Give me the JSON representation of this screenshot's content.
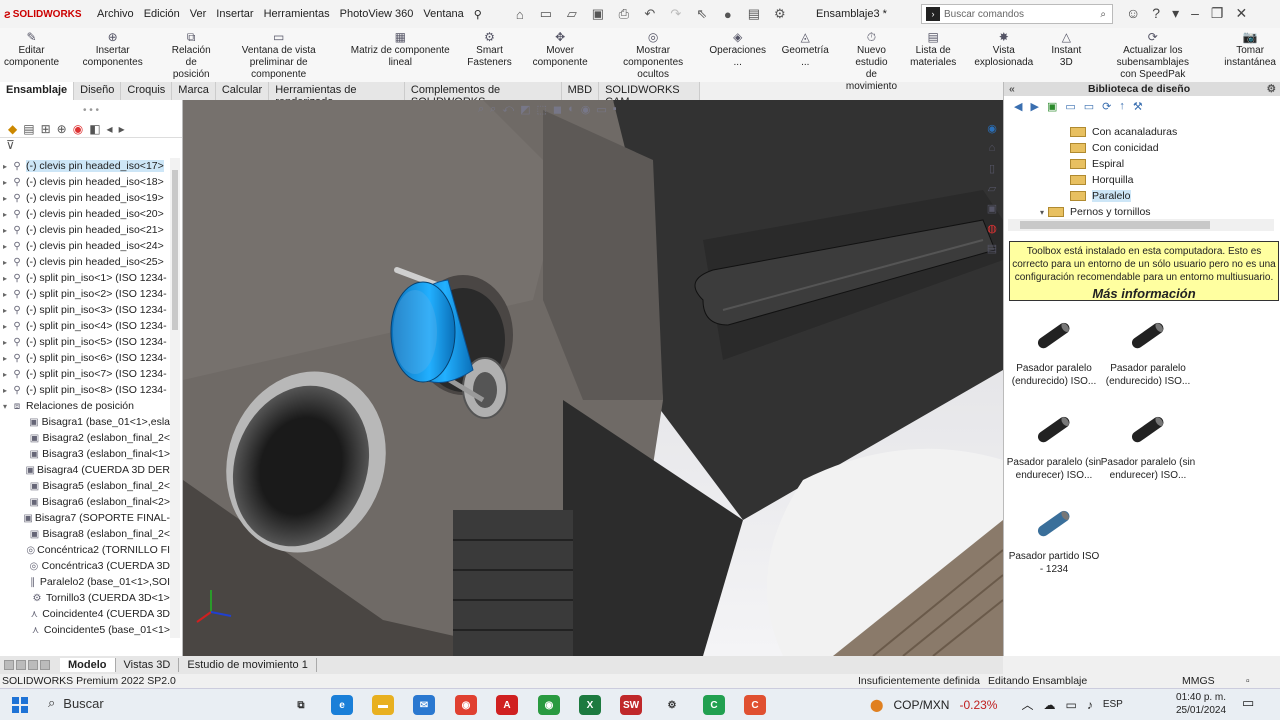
{
  "app": {
    "brand": "SOLIDWORKS",
    "doc_title": "Ensamblaje3 *"
  },
  "menu": [
    "Archivo",
    "Edición",
    "Ver",
    "Insertar",
    "Herramientas",
    "PhotoView 360",
    "Ventana"
  ],
  "search": {
    "placeholder": "Buscar comandos"
  },
  "ribbon": [
    {
      "label": "Editar\ncomponente",
      "icon": "edit-component-icon"
    },
    {
      "label": "Insertar componentes",
      "icon": "insert-components-icon"
    },
    {
      "label": "Relación de\nposición",
      "icon": "mate-icon"
    },
    {
      "label": "Ventana de vista\npreliminar de componente",
      "icon": "preview-window-icon"
    },
    {
      "label": "Matriz de componente lineal",
      "icon": "linear-pattern-icon"
    },
    {
      "label": "Smart\nFasteners",
      "icon": "smart-fasteners-icon"
    },
    {
      "label": "Mover componente",
      "icon": "move-component-icon"
    },
    {
      "label": "Mostrar\ncomponentes ocultos",
      "icon": "show-hidden-icon"
    },
    {
      "label": "Operaciones ...",
      "icon": "features-icon"
    },
    {
      "label": "Geometría ...",
      "icon": "geometry-icon"
    },
    {
      "label": "Nuevo estudio\nde movimiento",
      "icon": "motion-study-icon"
    },
    {
      "label": "Lista de\nmateriales",
      "icon": "bom-icon"
    },
    {
      "label": "Vista explosionada",
      "icon": "exploded-view-icon"
    },
    {
      "label": "Instant\n3D",
      "icon": "instant3d-icon"
    },
    {
      "label": "Actualizar los subensamblajes\ncon SpeedPak",
      "icon": "speedpak-icon"
    },
    {
      "label": "Tomar\ninstantánea",
      "icon": "snapshot-icon"
    }
  ],
  "tabs": [
    "Ensamblaje",
    "Diseño",
    "Croquis",
    "Marca",
    "Calcular",
    "Herramientas de renderizado",
    "Complementos de SOLIDWORKS",
    "MBD",
    "SOLIDWORKS CAM"
  ],
  "tree": [
    {
      "label": "(-) clevis pin headed_iso<17>",
      "icon": "part-icon",
      "selected": true
    },
    {
      "label": "(-) clevis pin headed_iso<18>",
      "icon": "part-icon"
    },
    {
      "label": "(-) clevis pin headed_iso<19>",
      "icon": "part-icon"
    },
    {
      "label": "(-) clevis pin headed_iso<20>",
      "icon": "part-icon"
    },
    {
      "label": "(-) clevis pin headed_iso<21>",
      "icon": "part-icon"
    },
    {
      "label": "(-) clevis pin headed_iso<24>",
      "icon": "part-icon"
    },
    {
      "label": "(-) clevis pin headed_iso<25>",
      "icon": "part-icon"
    },
    {
      "label": "(-) split pin_iso<1> (ISO 1234-",
      "icon": "part-icon"
    },
    {
      "label": "(-) split pin_iso<2> (ISO 1234-",
      "icon": "part-icon"
    },
    {
      "label": "(-) split pin_iso<3> (ISO 1234-",
      "icon": "part-icon"
    },
    {
      "label": "(-) split pin_iso<4> (ISO 1234-",
      "icon": "part-icon"
    },
    {
      "label": "(-) split pin_iso<5> (ISO 1234-",
      "icon": "part-icon"
    },
    {
      "label": "(-) split pin_iso<6> (ISO 1234-",
      "icon": "part-icon"
    },
    {
      "label": "(-) split pin_iso<7> (ISO 1234-",
      "icon": "part-icon"
    },
    {
      "label": "(-) split pin_iso<8> (ISO 1234-",
      "icon": "part-icon"
    },
    {
      "label": "Relaciones de posición",
      "icon": "mates-folder-icon",
      "level": 0
    },
    {
      "label": "Bisagra1 (base_01<1>,esla",
      "icon": "hinge-icon",
      "level": 1
    },
    {
      "label": "Bisagra2 (eslabon_final_2<",
      "icon": "hinge-icon",
      "level": 1
    },
    {
      "label": "Bisagra3 (eslabon_final<1>",
      "icon": "hinge-icon",
      "level": 1
    },
    {
      "label": "Bisagra4 (CUERDA 3D DER",
      "icon": "hinge-icon",
      "level": 1
    },
    {
      "label": "Bisagra5 (eslabon_final_2<",
      "icon": "hinge-icon",
      "level": 1
    },
    {
      "label": "Bisagra6 (eslabon_final<2>",
      "icon": "hinge-icon",
      "level": 1
    },
    {
      "label": "Bisagra7 (SOPORTE FINAL-",
      "icon": "hinge-icon",
      "level": 1
    },
    {
      "label": "Bisagra8 (eslabon_final_2<",
      "icon": "hinge-icon",
      "level": 1
    },
    {
      "label": "Concéntrica2 (TORNILLO FI",
      "icon": "concentric-icon",
      "level": 1
    },
    {
      "label": "Concéntrica3 (CUERDA 3D",
      "icon": "concentric-icon",
      "level": 1
    },
    {
      "label": "Paralelo2 (base_01<1>,SOI",
      "icon": "parallel-icon",
      "level": 1
    },
    {
      "label": "Tornillo3 (CUERDA 3D<1>",
      "icon": "screw-icon",
      "level": 1
    },
    {
      "label": "Coincidente4 (CUERDA 3D",
      "icon": "coincident-icon",
      "level": 1
    },
    {
      "label": "Coincidente5 (base_01<1>",
      "icon": "coincident-icon",
      "level": 1
    }
  ],
  "library": {
    "title": "Biblioteca de diseño",
    "folders": [
      {
        "label": "Con acanaladuras"
      },
      {
        "label": "Con conicidad"
      },
      {
        "label": "Espiral"
      },
      {
        "label": "Horquilla"
      },
      {
        "label": "Paralelo",
        "selected": true
      },
      {
        "label": "Pernos y tornillos",
        "expanded": true
      }
    ],
    "note": "Toolbox está instalado en esta computadora. Esto es correcto para un entorno de un sólo usuario pero no es una configuración recomendable para un entorno multiusuario.",
    "more": "Más información",
    "parts": [
      {
        "label": "Pasador paralelo (endurecido) ISO..."
      },
      {
        "label": "Pasador paralelo (endurecido) ISO..."
      },
      {
        "label": "Pasador paralelo (sin endurecer) ISO..."
      },
      {
        "label": "Pasador paralelo (sin endurecer) ISO..."
      },
      {
        "label": "Pasador partido ISO - 1234"
      }
    ]
  },
  "bottom_tabs": [
    "Modelo",
    "Vistas 3D",
    "Estudio de movimiento 1"
  ],
  "status": {
    "version": "SOLIDWORKS Premium 2022 SP2.0",
    "definition": "Insuficientemente definida",
    "mode": "Editando Ensamblaje",
    "units": "MMGS"
  },
  "taskbar": {
    "search": "Buscar",
    "ticker": "COP/MXN",
    "change": "-0.23%",
    "lang": "ESP",
    "time": "01:40 p. m.",
    "date": "25/01/2024"
  },
  "colors": {
    "selection": "#1e9be8",
    "note_bg": "#ffffa0",
    "brand": "#cc0000"
  }
}
